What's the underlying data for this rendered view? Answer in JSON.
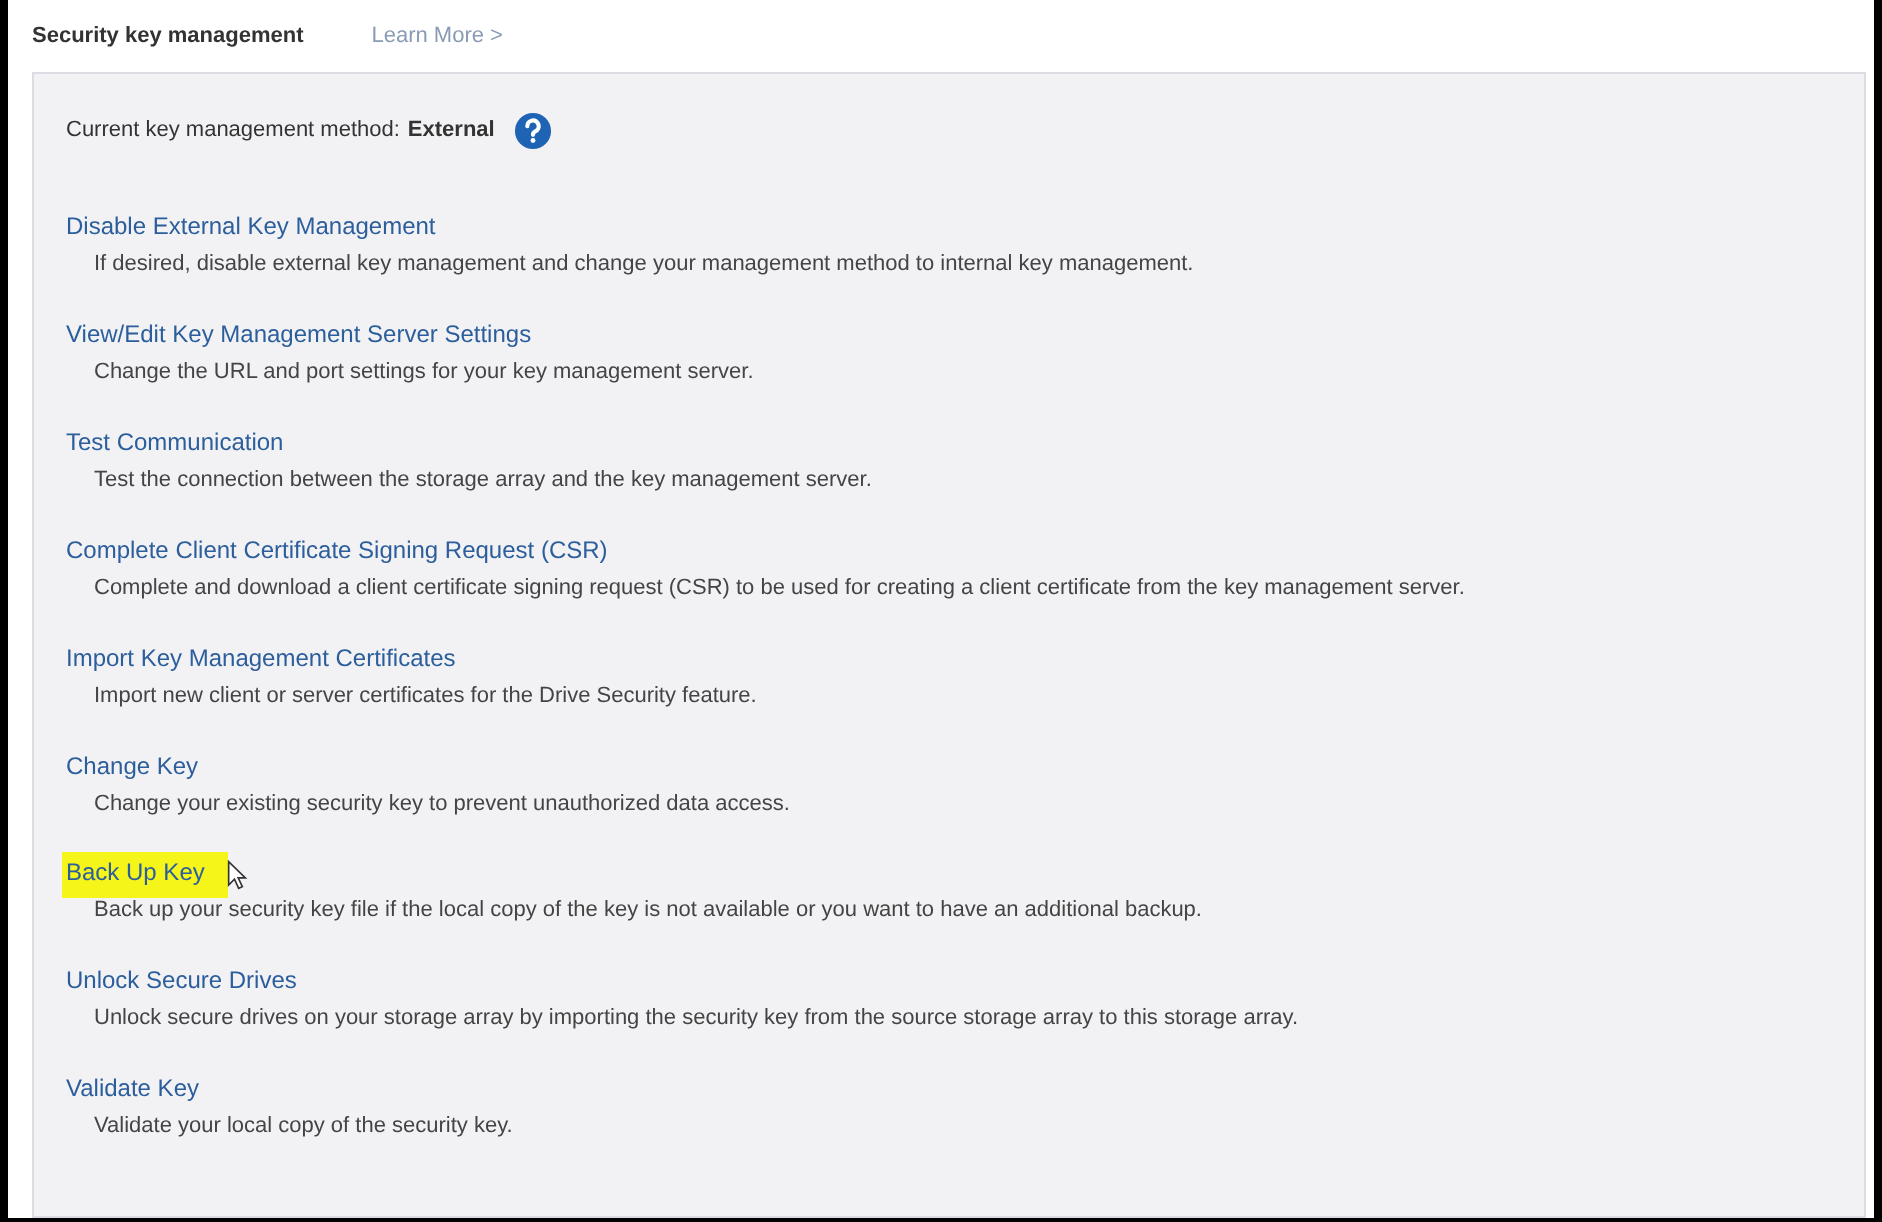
{
  "header": {
    "title": "Security key management",
    "learn_more": "Learn More >"
  },
  "current_method": {
    "label": "Current key management method:",
    "value": "External"
  },
  "actions": [
    {
      "link": "Disable External Key Management",
      "description": "If desired, disable external key management and change your management method to internal key management.",
      "highlighted": false
    },
    {
      "link": "View/Edit Key Management Server Settings",
      "description": "Change the URL and port settings for your key management server.",
      "highlighted": false
    },
    {
      "link": "Test Communication",
      "description": "Test the connection between the storage array and the key management server.",
      "highlighted": false
    },
    {
      "link": "Complete Client Certificate Signing Request (CSR)",
      "description": "Complete and download a client certificate signing request (CSR) to be used for creating a client certificate from the key management server.",
      "highlighted": false
    },
    {
      "link": "Import Key Management Certificates",
      "description": "Import new client or server certificates for the Drive Security feature.",
      "highlighted": false
    },
    {
      "link": "Change Key",
      "description": "Change your existing security key to prevent unauthorized data access.",
      "highlighted": false
    },
    {
      "link": "Back Up Key",
      "description": "Back up your security key file if the local copy of the key is not available or you want to have an additional backup.",
      "highlighted": true
    },
    {
      "link": "Unlock Secure Drives",
      "description": "Unlock secure drives on your storage array by importing the security key from the source storage array to this storage array.",
      "highlighted": false
    },
    {
      "link": "Validate Key",
      "description": "Validate your local copy of the security key.",
      "highlighted": false
    }
  ]
}
